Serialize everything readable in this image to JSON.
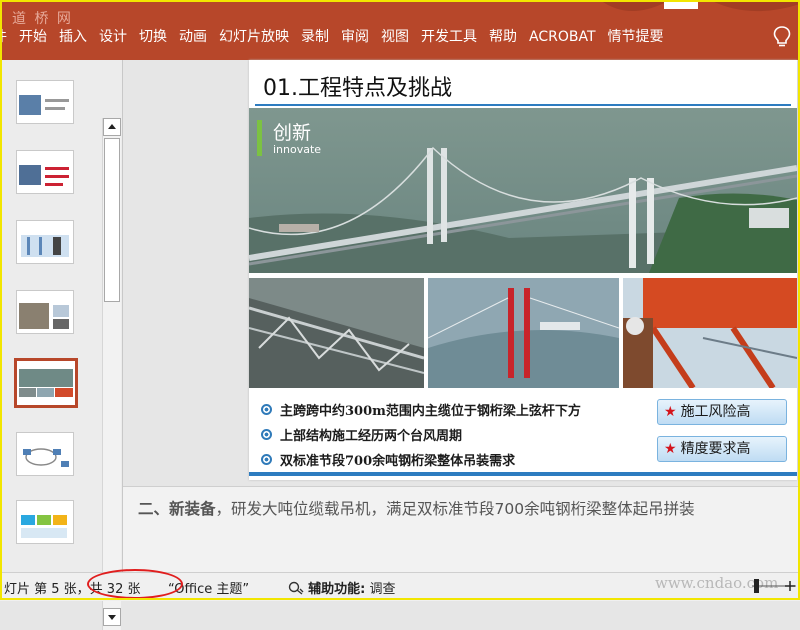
{
  "ribbon": {
    "watermark": "道 桥 网",
    "tabs": [
      "件",
      "开始",
      "插入",
      "设计",
      "切换",
      "动画",
      "幻灯片放映",
      "录制",
      "审阅",
      "视图",
      "开发工具",
      "帮助",
      "ACROBAT",
      "情节提要"
    ]
  },
  "slide": {
    "title": "01.工程特点及挑战",
    "hero_heading": "创新",
    "hero_subheading": "innovate",
    "bullets": [
      "主跨跨中约300m范围内主缆位于钢桁梁上弦杆下方",
      "上部结构施工经历两个台风周期",
      "双标准节段700余吨钢桁梁整体吊装需求"
    ],
    "tags": [
      {
        "star": "★",
        "label": "施工风险高"
      },
      {
        "star": "★",
        "label": "精度要求高"
      }
    ]
  },
  "notes": {
    "prefix": "二、",
    "bold": "新装备",
    "text": "，研发大吨位缆载吊机，满足双标准节段700余吨钢桁梁整体起吊拼装"
  },
  "status": {
    "slide_info": "灯片 第 5 张，共 32 张",
    "theme": "“Office 主题”",
    "accessibility_label": "辅助功能:",
    "accessibility_value": "调查",
    "site_watermark": "www.cndao.com"
  },
  "thumbnails": {
    "count_visible": 7,
    "selected_index": 4
  },
  "colors": {
    "ribbon": "#b7472a",
    "accent_blue": "#2d7cc0",
    "accent_green": "#7cc242",
    "highlight_red": "#e01e1e",
    "frame_yellow": "#f2e600"
  }
}
